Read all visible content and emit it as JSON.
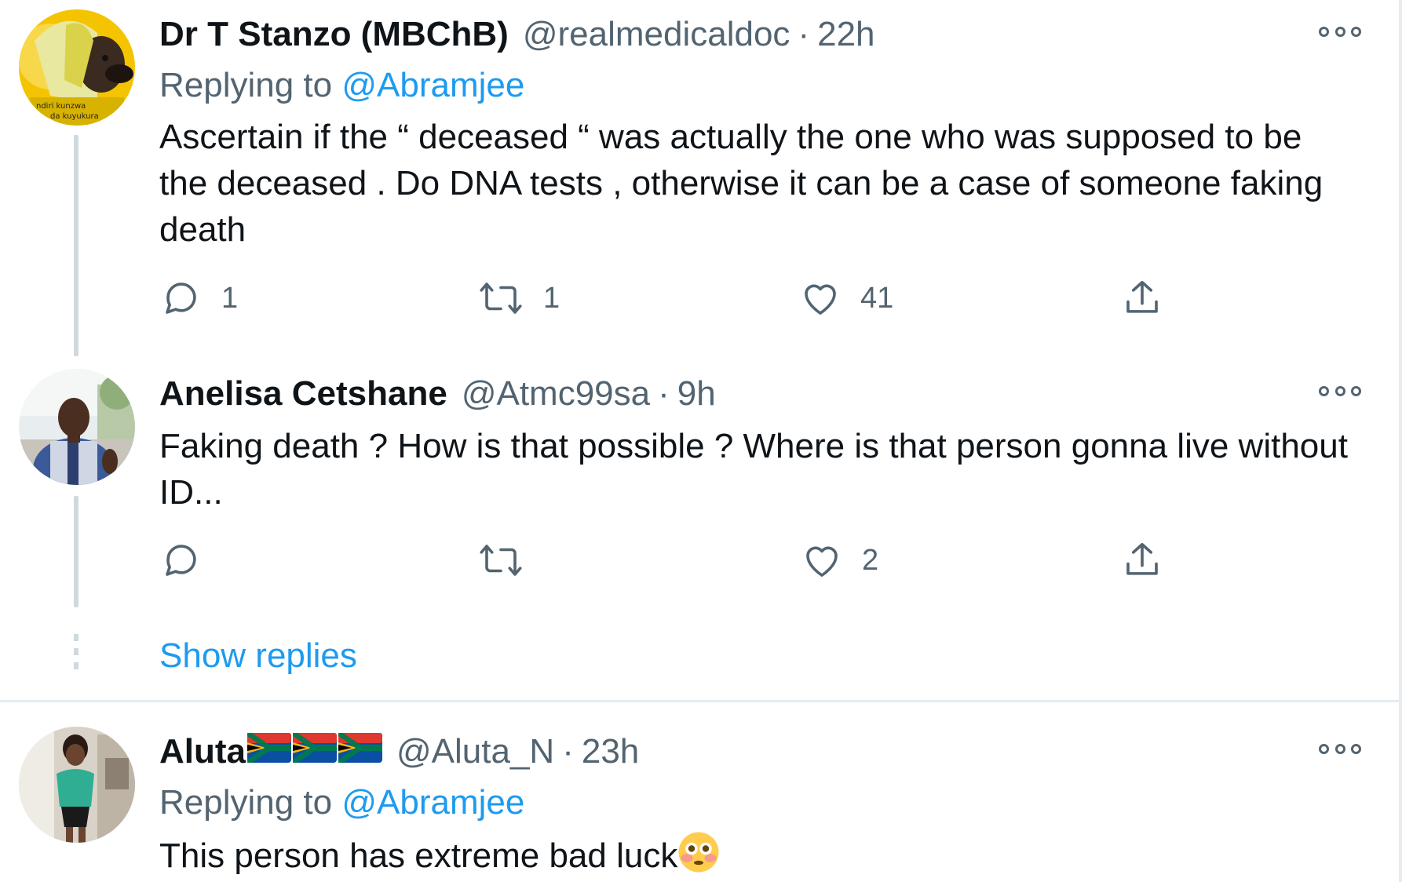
{
  "tweets": [
    {
      "author_name": "Dr T Stanzo (MBChB)",
      "handle": "@realmedicaldoc",
      "separator": "·",
      "time": "22h",
      "replying_prefix": "Replying to ",
      "replying_to": "@Abramjee",
      "text": "Ascertain if the “ deceased “ was actually the one who was supposed to be the deceased . Do DNA tests , otherwise it can be a case of someone faking death",
      "avatar_caption_1": "ndiri kunzwa",
      "avatar_caption_2": "da kuyukura",
      "reply_count": "1",
      "retweet_count": "1",
      "like_count": "41"
    },
    {
      "author_name": "Anelisa Cetshane",
      "handle": "@Atmc99sa",
      "separator": "·",
      "time": "9h",
      "text": "Faking death ? How is that possible ? Where is that person gonna live without ID...",
      "reply_count": "",
      "retweet_count": "",
      "like_count": "2"
    },
    {
      "author_name": "Aluta",
      "flags": [
        "south-africa-flag",
        "south-africa-flag",
        "south-africa-flag"
      ],
      "handle": "@Aluta_N",
      "separator": "·",
      "time": "23h",
      "replying_prefix": "Replying to ",
      "replying_to": "@Abramjee",
      "text": "This person has extreme bad luck",
      "emoji": "flushed-face-emoji"
    }
  ],
  "show_replies_label": "Show replies",
  "colors": {
    "link": "#1d9bf0",
    "secondary_text": "#536471",
    "primary_text": "#0f1419",
    "thread_line": "#cfd9de",
    "divider": "#e6ecf0"
  },
  "icons": [
    "reply-icon",
    "retweet-icon",
    "like-icon",
    "share-icon",
    "more-icon"
  ]
}
